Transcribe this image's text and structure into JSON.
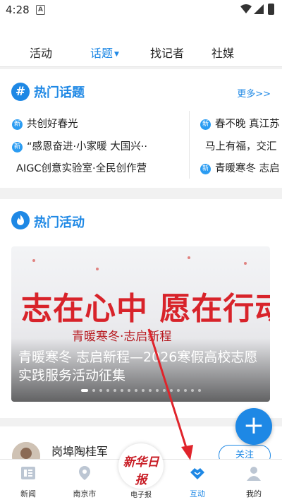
{
  "status": {
    "time": "4:28",
    "notif_glyph": "A"
  },
  "tabs": [
    {
      "label": "活动"
    },
    {
      "label": "话题",
      "active": true
    },
    {
      "label": "找记者"
    },
    {
      "label": "社媒"
    }
  ],
  "hot_topics": {
    "title": "热门话题",
    "more": "更多>>",
    "badge": "新",
    "left": [
      {
        "text": "共创好春光",
        "badge": true
      },
      {
        "text": "“感恩奋进·小家暖 大国兴··",
        "badge": true
      },
      {
        "text": "AIGC创意实验室·全民创作营",
        "badge": false
      }
    ],
    "right": [
      {
        "text": "春不晚 真江苏",
        "badge": true
      },
      {
        "text": "马上有福，交汇",
        "badge": false
      },
      {
        "text": "青暖寒冬 志启",
        "badge": true
      }
    ]
  },
  "hot_activities": {
    "title": "热门活动",
    "banner_headline": "志在心中 愿在行动",
    "banner_sub": "青暖寒冬·志启新程",
    "caption": "青暖寒冬 志启新程—2026寒假高校志愿实践服务活动征集"
  },
  "reporter": {
    "name": "岗埠陶桂军",
    "follow": "关注"
  },
  "bottom_nav": [
    {
      "label": "新闻",
      "icon": "news-icon"
    },
    {
      "label": "南京市",
      "icon": "location-icon"
    },
    {
      "label": "电子报",
      "icon": "newspaper-logo",
      "logo": "新华日报"
    },
    {
      "label": "互动",
      "icon": "handshake-icon",
      "active": true
    },
    {
      "label": "我的",
      "icon": "profile-icon"
    }
  ],
  "colors": {
    "accent": "#1e88e5",
    "banner_red": "#d8232a",
    "arrow": "#e0242b"
  }
}
